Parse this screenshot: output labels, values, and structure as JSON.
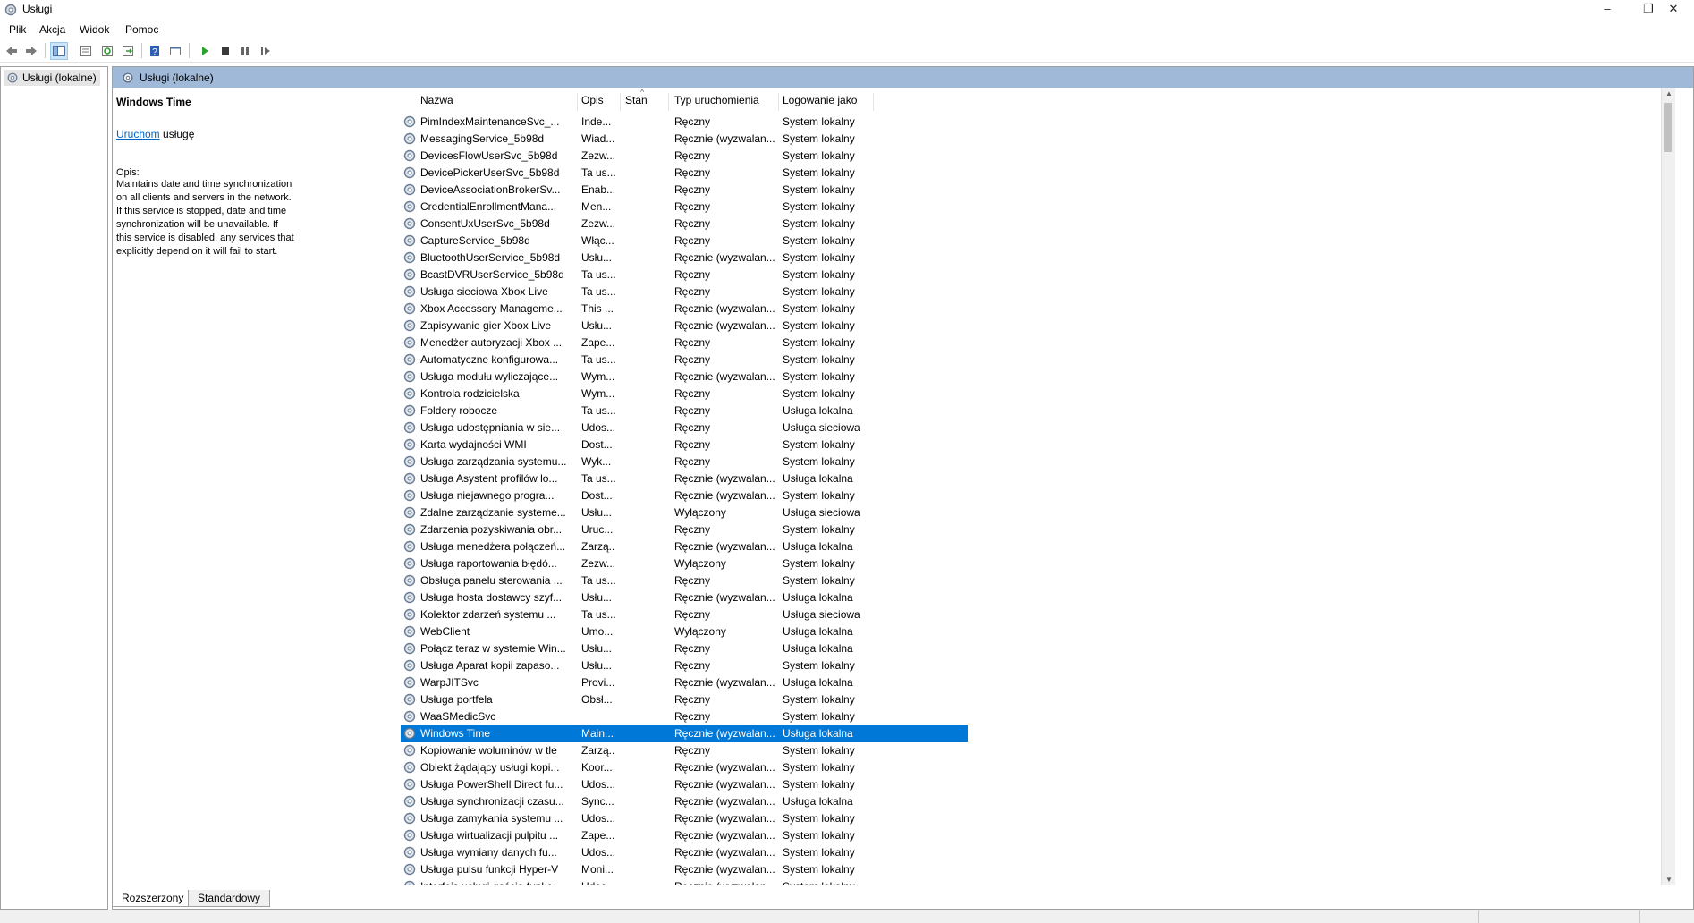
{
  "window": {
    "title": "Usługi",
    "minimize": "–",
    "restore": "❐",
    "close": "✕"
  },
  "menu": [
    "Plik",
    "Akcja",
    "Widok",
    "Pomoc"
  ],
  "toolbar": {
    "icons": [
      "back-arrow-icon",
      "forward-arrow-icon",
      "show-hide-tree-icon",
      "properties-icon",
      "refresh-icon",
      "export-list-icon",
      "help-icon",
      "console-view-icon",
      "start-service-icon",
      "stop-service-icon",
      "pause-service-icon",
      "restart-service-icon"
    ]
  },
  "tree": {
    "item": "Usługi (lokalne)"
  },
  "pane": {
    "header": "Usługi (lokalne)",
    "selected_service": "Windows Time",
    "action_link": "Uruchom",
    "action_rest": " usługę",
    "desc_label": "Opis:",
    "description": "Maintains date and time synchronization on all clients and servers in the network. If this service is stopped, date and time synchronization will be unavailable. If this service is disabled, any services that explicitly depend on it will fail to start."
  },
  "table": {
    "columns": [
      "Nazwa",
      "Opis",
      "Stan",
      "Typ uruchomienia",
      "Logowanie jako"
    ],
    "sort_indicator": "^",
    "selected_index": 36,
    "rows": [
      [
        "PimIndexMaintenanceSvc_...",
        "Inde...",
        "",
        "Ręczny",
        "System lokalny"
      ],
      [
        "MessagingService_5b98d",
        "Wiad...",
        "",
        "Ręcznie (wyzwalan...",
        "System lokalny"
      ],
      [
        "DevicesFlowUserSvc_5b98d",
        "Zezw...",
        "",
        "Ręczny",
        "System lokalny"
      ],
      [
        "DevicePickerUserSvc_5b98d",
        "Ta us...",
        "",
        "Ręczny",
        "System lokalny"
      ],
      [
        "DeviceAssociationBrokerSv...",
        "Enab...",
        "",
        "Ręczny",
        "System lokalny"
      ],
      [
        "CredentialEnrollmentMana...",
        "Men...",
        "",
        "Ręczny",
        "System lokalny"
      ],
      [
        "ConsentUxUserSvc_5b98d",
        "Zezw...",
        "",
        "Ręczny",
        "System lokalny"
      ],
      [
        "CaptureService_5b98d",
        "Włąc...",
        "",
        "Ręczny",
        "System lokalny"
      ],
      [
        "BluetoothUserService_5b98d",
        "Usłu...",
        "",
        "Ręcznie (wyzwalan...",
        "System lokalny"
      ],
      [
        "BcastDVRUserService_5b98d",
        "Ta us...",
        "",
        "Ręczny",
        "System lokalny"
      ],
      [
        "Usługa sieciowa Xbox Live",
        "Ta us...",
        "",
        "Ręczny",
        "System lokalny"
      ],
      [
        "Xbox Accessory Manageme...",
        "This ...",
        "",
        "Ręcznie (wyzwalan...",
        "System lokalny"
      ],
      [
        "Zapisywanie gier Xbox Live",
        "Usłu...",
        "",
        "Ręcznie (wyzwalan...",
        "System lokalny"
      ],
      [
        "Menedżer autoryzacji Xbox ...",
        "Zape...",
        "",
        "Ręczny",
        "System lokalny"
      ],
      [
        "Automatyczne konfigurowa...",
        "Ta us...",
        "",
        "Ręczny",
        "System lokalny"
      ],
      [
        "Usługa modułu wyliczające...",
        "Wym...",
        "",
        "Ręcznie (wyzwalan...",
        "System lokalny"
      ],
      [
        "Kontrola rodzicielska",
        "Wym...",
        "",
        "Ręczny",
        "System lokalny"
      ],
      [
        "Foldery robocze",
        "Ta us...",
        "",
        "Ręczny",
        "Usługa lokalna"
      ],
      [
        "Usługa udostępniania w sie...",
        "Udos...",
        "",
        "Ręczny",
        "Usługa sieciowa"
      ],
      [
        "Karta wydajności WMI",
        "Dost...",
        "",
        "Ręczny",
        "System lokalny"
      ],
      [
        "Usługa zarządzania systemu...",
        "Wyk...",
        "",
        "Ręczny",
        "System lokalny"
      ],
      [
        "Usługa Asystent profilów lo...",
        "Ta us...",
        "",
        "Ręcznie (wyzwalan...",
        "Usługa lokalna"
      ],
      [
        "Usługa niejawnego progra...",
        "Dost...",
        "",
        "Ręcznie (wyzwalan...",
        "System lokalny"
      ],
      [
        "Zdalne zarządzanie systeme...",
        "Usłu...",
        "",
        "Wyłączony",
        "Usługa sieciowa"
      ],
      [
        "Zdarzenia pozyskiwania obr...",
        "Uruc...",
        "",
        "Ręczny",
        "System lokalny"
      ],
      [
        "Usługa menedżera połączeń...",
        "Zarzą...",
        "",
        "Ręcznie (wyzwalan...",
        "Usługa lokalna"
      ],
      [
        "Usługa raportowania błędó...",
        "Zezw...",
        "",
        "Wyłączony",
        "System lokalny"
      ],
      [
        "Obsługa panelu sterowania ...",
        "Ta us...",
        "",
        "Ręczny",
        "System lokalny"
      ],
      [
        "Usługa hosta dostawcy szyf...",
        "Usłu...",
        "",
        "Ręcznie (wyzwalan...",
        "Usługa lokalna"
      ],
      [
        "Kolektor zdarzeń systemu ...",
        "Ta us...",
        "",
        "Ręczny",
        "Usługa sieciowa"
      ],
      [
        "WebClient",
        "Umo...",
        "",
        "Wyłączony",
        "Usługa lokalna"
      ],
      [
        "Połącz teraz w systemie Win...",
        "Usłu...",
        "",
        "Ręczny",
        "Usługa lokalna"
      ],
      [
        "Usługa Aparat kopii zapaso...",
        "Usłu...",
        "",
        "Ręczny",
        "System lokalny"
      ],
      [
        "WarpJITSvc",
        "Provi...",
        "",
        "Ręcznie (wyzwalan...",
        "Usługa lokalna"
      ],
      [
        "Usługa portfela",
        "Obsł...",
        "",
        "Ręczny",
        "System lokalny"
      ],
      [
        "WaaSMedicSvc",
        "",
        "",
        "Ręczny",
        "System lokalny"
      ],
      [
        "Windows Time",
        "Main...",
        "",
        "Ręcznie (wyzwalan...",
        "Usługa lokalna"
      ],
      [
        "Kopiowanie woluminów w tle",
        "Zarzą...",
        "",
        "Ręczny",
        "System lokalny"
      ],
      [
        "Obiekt żądający usługi kopi...",
        "Koor...",
        "",
        "Ręcznie (wyzwalan...",
        "System lokalny"
      ],
      [
        "Usługa PowerShell Direct fu...",
        "Udos...",
        "",
        "Ręcznie (wyzwalan...",
        "System lokalny"
      ],
      [
        "Usługa synchronizacji czasu...",
        "Sync...",
        "",
        "Ręcznie (wyzwalan...",
        "Usługa lokalna"
      ],
      [
        "Usługa zamykania systemu ...",
        "Udos...",
        "",
        "Ręcznie (wyzwalan...",
        "System lokalny"
      ],
      [
        "Usługa wirtualizacji pulpitu ...",
        "Zape...",
        "",
        "Ręcznie (wyzwalan...",
        "System lokalny"
      ],
      [
        "Usługa wymiany danych fu...",
        "Udos...",
        "",
        "Ręcznie (wyzwalan...",
        "System lokalny"
      ],
      [
        "Usługa pulsu funkcji Hyper-V",
        "Moni...",
        "",
        "Ręcznie (wyzwalan...",
        "System lokalny"
      ],
      [
        "Interfejs usługi gościa funkc...",
        "Udos...",
        "",
        "Ręcznie (wyzwalan...",
        "System lokalny"
      ]
    ]
  },
  "tabs": [
    "Rozszerzony",
    "Standardowy"
  ],
  "colors": {
    "selection": "#0078d7",
    "pane_header": "#a0b9d8",
    "link": "#0066cc"
  }
}
